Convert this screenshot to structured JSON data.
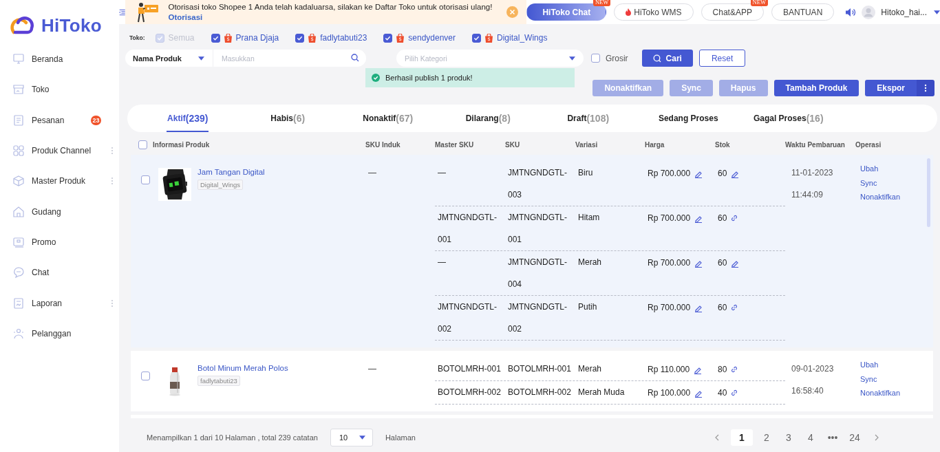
{
  "sidebar": {
    "logo": "HiToko",
    "items": [
      {
        "label": "Beranda",
        "selected": false,
        "has_menu": false
      },
      {
        "label": "Toko",
        "selected": false,
        "has_menu": false
      },
      {
        "label": "Pesanan",
        "selected": false,
        "has_menu": false,
        "badge": "23"
      },
      {
        "label": "Produk Channel",
        "selected": false,
        "has_menu": true
      },
      {
        "label": "Master Produk",
        "selected": false,
        "has_menu": true
      },
      {
        "label": "Gudang",
        "selected": false,
        "has_menu": false
      },
      {
        "label": "Promo",
        "selected": false,
        "has_menu": false
      },
      {
        "label": "Chat",
        "selected": false,
        "has_menu": false
      },
      {
        "label": "Laporan",
        "selected": false,
        "has_menu": true
      },
      {
        "label": "Pelanggan",
        "selected": false,
        "has_menu": false
      }
    ]
  },
  "topbar": {
    "notice": {
      "text": "Otorisasi toko Shopee 1 Anda telah kadaluarsa, silakan ke Daftar Toko untuk otorisasi ulang!",
      "link": "Otorisasi"
    },
    "buttons": [
      {
        "label": "HiToko Chat",
        "kind": "gradient",
        "badge": "NEW"
      },
      {
        "label": "HiToko WMS",
        "kind": "hot"
      },
      {
        "label": "Chat&APP",
        "kind": "plain",
        "badge": "NEW"
      },
      {
        "label": "BANTUAN",
        "kind": "plain"
      }
    ],
    "username": "Hitoko_hai..."
  },
  "store_filter": {
    "label": "Toko:",
    "all": {
      "label": "Semua",
      "checked": true,
      "disabled": true
    },
    "stores": [
      {
        "name": "Prana Djaja",
        "checked": true
      },
      {
        "name": "fadlytabuti23",
        "checked": true
      },
      {
        "name": "sendydenver",
        "checked": true
      },
      {
        "name": "Digital_Wings",
        "checked": true
      }
    ]
  },
  "search": {
    "field_select": "Nama Produk",
    "placeholder": "Masukkan",
    "category_placeholder": "Pilih Kategori",
    "grosir": {
      "label": "Grosir",
      "checked": false
    },
    "search_button": "Cari",
    "reset_button": "Reset"
  },
  "toast": "Berhasil publish 1 produk!",
  "actions": [
    {
      "label": "Nonaktifkan",
      "disabled": true,
      "has_menu": false
    },
    {
      "label": "Sync",
      "disabled": true,
      "has_menu": false
    },
    {
      "label": "Hapus",
      "disabled": true,
      "has_menu": false
    },
    {
      "label": "Tambah Produk",
      "disabled": false,
      "has_menu": false
    },
    {
      "label": "Ekspor",
      "disabled": false,
      "has_menu": true
    }
  ],
  "tabs": [
    {
      "label": "Aktif",
      "count": "(239)",
      "selected": true
    },
    {
      "label": "Habis",
      "count": "(6)",
      "selected": false
    },
    {
      "label": "Nonaktif",
      "count": "(67)",
      "selected": false
    },
    {
      "label": "Dilarang",
      "count": "(8)",
      "selected": false
    },
    {
      "label": "Draft",
      "count": "(108)",
      "selected": false
    },
    {
      "label": "Sedang Proses",
      "selected": false
    },
    {
      "label": "Gagal Proses",
      "count": "(16)",
      "selected": false
    }
  ],
  "table": {
    "select_all": {
      "checked": false
    },
    "columns": [
      "Informasi Produk",
      "SKU Induk",
      "Master SKU",
      "SKU",
      "Variasi",
      "Harga",
      "Stok",
      "Waktu Pembaruan",
      "Operasi"
    ],
    "products": [
      {
        "name": "Jam Tangan Digital",
        "store": "Digital_Wings",
        "checked": false,
        "hovered": true,
        "sku_induk": "—",
        "updated": "11-01-2023 11:44:09",
        "operations": [
          "Ubah",
          "Sync",
          "Nonaktifkan"
        ],
        "variants": [
          {
            "master_sku": "—",
            "sku": "JMTNGNDGTL-003",
            "variation": "Biru",
            "price": "Rp 700.000",
            "stock": "60",
            "stock_linked": false
          },
          {
            "master_sku": "JMTNGNDGTL-001",
            "sku": "JMTNGNDGTL-001",
            "variation": "Hitam",
            "price": "Rp 700.000",
            "stock": "60",
            "stock_linked": true
          },
          {
            "master_sku": "—",
            "sku": "JMTNGNDGTL-004",
            "variation": "Merah",
            "price": "Rp 700.000",
            "stock": "60",
            "stock_linked": false
          },
          {
            "master_sku": "JMTNGNDGTL-002",
            "sku": "JMTNGNDGTL-002",
            "variation": "Putih",
            "price": "Rp 700.000",
            "stock": "60",
            "stock_linked": true
          }
        ]
      },
      {
        "name": "Botol Minum Merah Polos",
        "store": "fadlytabuti23",
        "checked": false,
        "hovered": false,
        "sku_induk": "—",
        "updated": "09-01-2023 16:58:40",
        "operations": [
          "Ubah",
          "Sync",
          "Nonaktifkan"
        ],
        "variants": [
          {
            "master_sku": "BOTOLMRH-001",
            "sku": "BOTOLMRH-001",
            "variation": "Merah",
            "price": "Rp 110.000",
            "stock": "80",
            "stock_linked": true
          },
          {
            "master_sku": "BOTOLMRH-002",
            "sku": "BOTOLMRH-002",
            "variation": "Merah Muda",
            "price": "Rp 100.000",
            "stock": "40",
            "stock_linked": true
          }
        ]
      }
    ]
  },
  "footer": {
    "summary": "Menampilkan 1 dari 10 Halaman , total 239 catatan",
    "page_size": "10",
    "page_size_suffix": "Halaman",
    "pages": [
      {
        "label": "1",
        "selected": true
      },
      {
        "label": "2",
        "selected": false
      },
      {
        "label": "3",
        "selected": false
      },
      {
        "label": "4",
        "selected": false
      },
      {
        "label": "•••",
        "selected": false
      },
      {
        "label": "24",
        "selected": false
      }
    ]
  }
}
